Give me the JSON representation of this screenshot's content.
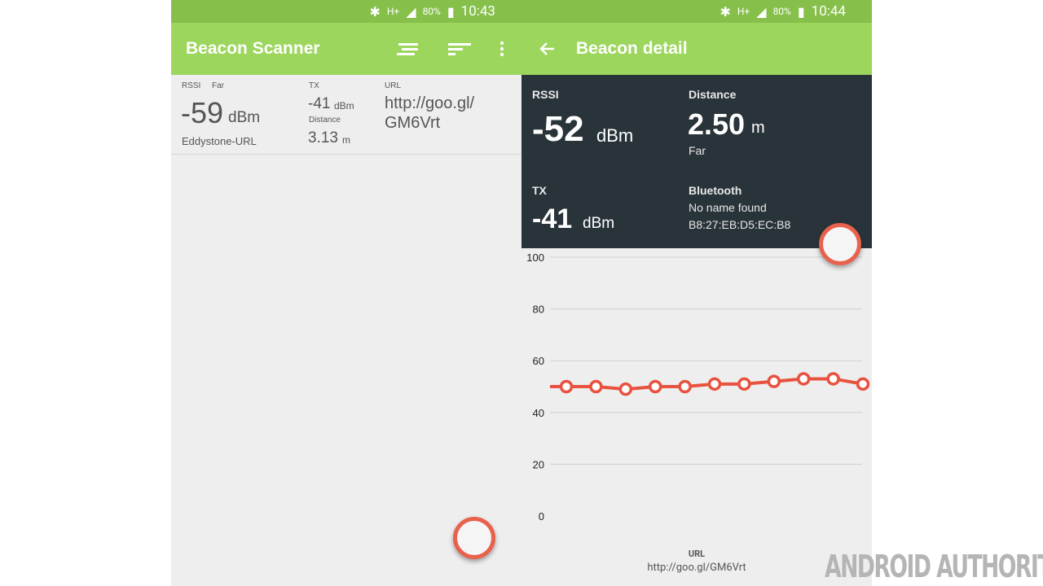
{
  "left": {
    "status": {
      "battery": "80%",
      "time": "10:43",
      "network": "H+"
    },
    "appbar": {
      "title": "Beacon Scanner"
    },
    "beacon": {
      "rssi_label": "RSSI",
      "proximity": "Far",
      "rssi_value": "-59",
      "rssi_unit": "dBm",
      "type": "Eddystone-URL",
      "tx_label": "TX",
      "tx_value": "-41",
      "tx_unit": "dBm",
      "distance_label": "Distance",
      "distance_value": "3.13",
      "distance_unit": "m",
      "url_label": "URL",
      "url_line1": "http://goo.gl/",
      "url_line2": "GM6Vrt"
    }
  },
  "right": {
    "status": {
      "battery": "80%",
      "time": "10:44",
      "network": "H+"
    },
    "appbar": {
      "title": "Beacon detail"
    },
    "detail": {
      "rssi_label": "RSSI",
      "rssi_value": "-52",
      "rssi_unit": "dBm",
      "distance_label": "Distance",
      "distance_value": "2.50",
      "distance_unit": "m",
      "proximity": "Far",
      "tx_label": "TX",
      "tx_value": "-41",
      "tx_unit": "dBm",
      "bluetooth_label": "Bluetooth",
      "bluetooth_name": "No name found",
      "bluetooth_mac": "B8:27:EB:D5:EC:B8"
    },
    "footer": {
      "url_label": "URL",
      "url": "http://goo.gl/GM6Vrt"
    }
  },
  "chart_data": {
    "type": "line",
    "y_ticks": [
      "100",
      "80",
      "60",
      "40",
      "20",
      "0"
    ],
    "ylim": [
      0,
      100
    ],
    "grid": true,
    "values": [
      50,
      50,
      50,
      49,
      50,
      50,
      51,
      51,
      52,
      53,
      53,
      51
    ],
    "color": "#e8523f"
  },
  "watermark": "ANDROID AUTHORITY",
  "colors": {
    "appbar": "#9cd65d",
    "statusbar": "#86c04a",
    "card": "#29343a",
    "accent": "#e8614c"
  }
}
